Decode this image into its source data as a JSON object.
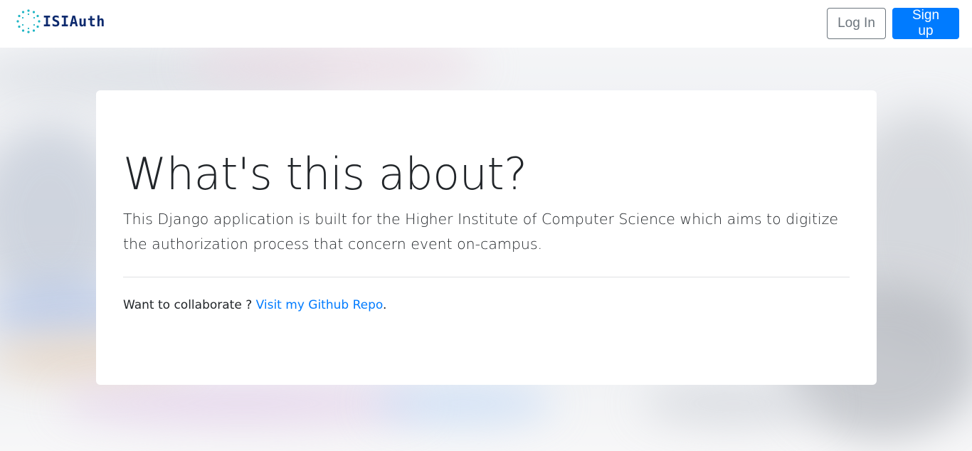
{
  "navbar": {
    "brand_text": "ISIAuth",
    "brand_icon": "dotted-circle-logo-icon",
    "login_label": "Log In",
    "signup_label": "Sign up"
  },
  "hero": {
    "title": "What's this about?",
    "lead": "This Django application is built for the Higher Institute of Computer Science which aims to digitize the authorization process that concern event on-campus.",
    "collab_prefix": "Want to collaborate ? ",
    "collab_link": "Visit my Github Repo",
    "collab_suffix": "."
  },
  "colors": {
    "primary": "#007bff",
    "outline": "#6c757d",
    "brand": "#0d2a6e",
    "logo_dots": "#1fb5c4"
  }
}
